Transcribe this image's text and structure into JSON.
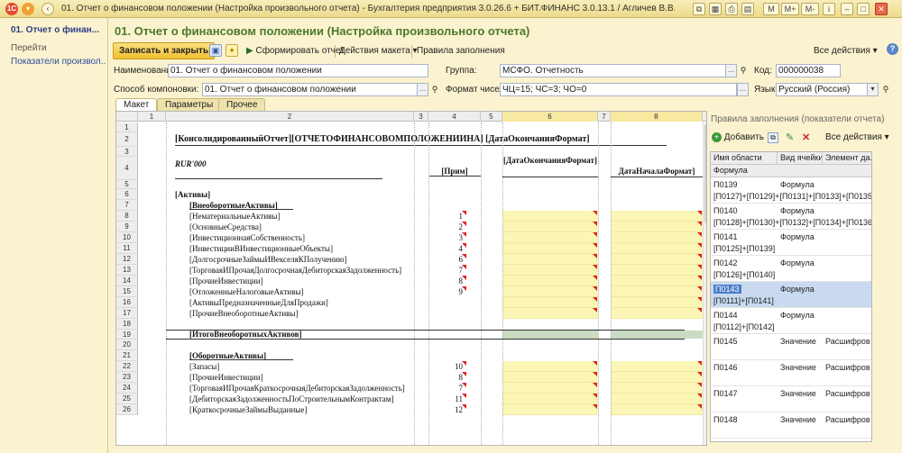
{
  "window": {
    "title": "01. Отчет о финансовом положении (Настройка произвольного отчета) - Бухгалтерия предприятия 3.0.26.6 + БИТ.ФИНАНС 3.0.13.1 / Агличев В.В. / Бу... (1С:Предприятие)",
    "buttons": [
      "M",
      "M+",
      "M-"
    ]
  },
  "left_panel": {
    "heading": "01. Отчет о финан...",
    "section": "Перейти",
    "link": "Показатели произвол..."
  },
  "page": {
    "title": "01. Отчет о финансовом положении (Настройка произвольного отчета)"
  },
  "toolbar": {
    "save_close": "Записать и закрыть",
    "generate": "Сформировать отчет",
    "layout_actions": "Действия макета",
    "fill_rules": "Правила заполнения",
    "all_actions": "Все действия"
  },
  "form": {
    "name_label": "Наименование:",
    "name_value": "01. Отчет о финансовом положении",
    "group_label": "Группа:",
    "group_value": "МСФО. Отчетность",
    "code_label": "Код:",
    "code_value": "000000038",
    "layout_label": "Способ компоновки:",
    "layout_value": "01. Отчет о финансовом положении",
    "numfmt_label": "Формат чисел:",
    "numfmt_value": "ЧЦ=15; ЧС=3; ЧО=0",
    "lang_label": "Язык:",
    "lang_value": "Русский (Россия)"
  },
  "tabs": [
    "Макет",
    "Параметры",
    "Прочее"
  ],
  "sheet": {
    "columns": [
      "1",
      "2",
      "3",
      "4",
      "5",
      "6",
      "7",
      "8"
    ],
    "rows": [
      {
        "n": "1",
        "c2": "",
        "c4": "",
        "tri": false,
        "y": false,
        "g": false
      },
      {
        "n": "2",
        "c2": "[КонсолидированныйОтчет][ОТЧЕТОФИНАНСОВОМПОЛОЖЕНИИНА] [ДатаОкончанияФормат]",
        "c4": "",
        "tri": false,
        "y": false,
        "g": false
      },
      {
        "n": "3",
        "c2": "",
        "c4": "",
        "tri": false,
        "y": false,
        "g": false
      },
      {
        "n": "4",
        "c2": "RUR'000",
        "c4": "[Прим]",
        "c6": "[ДатаОкончанияФормат]",
        "c8": "ДатаНачалаФормат]",
        "tri": false,
        "y": false,
        "g": false
      },
      {
        "n": "5",
        "c2": "",
        "c4": "",
        "tri": false,
        "y": false,
        "g": false
      },
      {
        "n": "6",
        "c2": "[Активы]",
        "c4": "",
        "tri": false,
        "y": false,
        "g": false
      },
      {
        "n": "7",
        "c2": "[ВнеоборотныеАктивы]",
        "c4": "",
        "tri": false,
        "y": false,
        "g": false
      },
      {
        "n": "8",
        "c2": "[НематериальныеАктивы]",
        "c4": "1",
        "tri": true,
        "y": true,
        "g": false
      },
      {
        "n": "9",
        "c2": "[ОсновныеСредства]",
        "c4": "2",
        "tri": true,
        "y": true,
        "g": false
      },
      {
        "n": "10",
        "c2": "[ИнвестиционнаяСобственность]",
        "c4": "3",
        "tri": true,
        "y": true,
        "g": false
      },
      {
        "n": "11",
        "c2": "[ИнвестицииВИнвестиционныеОбъекты]",
        "c4": "4",
        "tri": true,
        "y": true,
        "g": false
      },
      {
        "n": "12",
        "c2": "[ДолгосрочныеЗаймыИВекселяКПолучению]",
        "c4": "6",
        "tri": true,
        "y": true,
        "g": false
      },
      {
        "n": "13",
        "c2": "[ТорговаяИПрочаяДолгосрочнаяДебиторскаяЗадолженность]",
        "c4": "7",
        "tri": true,
        "y": true,
        "g": false
      },
      {
        "n": "14",
        "c2": "[ПрочиеИнвестиции]",
        "c4": "8",
        "tri": true,
        "y": true,
        "g": false
      },
      {
        "n": "15",
        "c2": "[ОтложенныеНалоговыеАктивы]",
        "c4": "9",
        "tri": true,
        "y": true,
        "g": false
      },
      {
        "n": "16",
        "c2": "[АктивыПредназначенныеДляПродажи]",
        "c4": "",
        "tri": false,
        "y": true,
        "g": false
      },
      {
        "n": "17",
        "c2": "[ПрочиеВнеоборотныеАктивы]",
        "c4": "",
        "tri": false,
        "y": true,
        "g": false
      },
      {
        "n": "18",
        "c2": "",
        "c4": "",
        "tri": false,
        "y": false,
        "g": false
      },
      {
        "n": "19",
        "c2": "[ИтогоВнеоборотныхАктивов]",
        "c4": "",
        "tri": false,
        "y": false,
        "g": true
      },
      {
        "n": "20",
        "c2": "",
        "c4": "",
        "tri": false,
        "y": false,
        "g": false
      },
      {
        "n": "21",
        "c2": "[ОборотныеАктивы]",
        "c4": "",
        "tri": false,
        "y": false,
        "g": false
      },
      {
        "n": "22",
        "c2": "[Запасы]",
        "c4": "10",
        "tri": true,
        "y": true,
        "g": false
      },
      {
        "n": "23",
        "c2": "[ПрочиеИнвестиции]",
        "c4": "8",
        "tri": true,
        "y": true,
        "g": false
      },
      {
        "n": "24",
        "c2": "[ТорговаяИПрочаяКраткосрочнаяДебиторскаяЗадолженность]",
        "c4": "7",
        "tri": true,
        "y": true,
        "g": false
      },
      {
        "n": "25",
        "c2": "[ДебиторскаяЗадолженностьПоСтроительнымКонтрактам]",
        "c4": "11",
        "tri": true,
        "y": true,
        "g": false
      },
      {
        "n": "26",
        "c2": "[КраткосрочныеЗаймыВыданные]",
        "c4": "12",
        "tri": true,
        "y": true,
        "g": false
      }
    ]
  },
  "rules_panel": {
    "title": "Правила заполнения (показатели отчета)",
    "add": "Добавить",
    "all_actions": "Все действия",
    "col_area": "Имя области",
    "col_type": "Вид ячейки",
    "col_elem": "Элемент да...",
    "col_formula": "Формула",
    "rows": [
      {
        "name": "П0139",
        "type": "Формула",
        "elem": "",
        "formula": "[П0127]+[П0129]+[П0131]+[П0133]+[П0135]+[П",
        "sel": false
      },
      {
        "name": "П0140",
        "type": "Формула",
        "elem": "",
        "formula": "[П0128]+[П0130]+[П0132]+[П0134]+[П0136]+[П",
        "sel": false
      },
      {
        "name": "П0141",
        "type": "Формула",
        "elem": "",
        "formula": "[П0125]+[П0139]",
        "sel": false
      },
      {
        "name": "П0142",
        "type": "Формула",
        "elem": "",
        "formula": "[П0126]+[П0140]",
        "sel": false
      },
      {
        "name": "П0143",
        "type": "Формула",
        "elem": "",
        "formula": "[П0111]+[П0141]",
        "sel": true
      },
      {
        "name": "П0144",
        "type": "Формула",
        "elem": "",
        "formula": "[П0112]+[П0142]",
        "sel": false
      },
      {
        "name": "П0145",
        "type": "Значение",
        "elem": "Расшифров",
        "formula": "",
        "sel": false
      },
      {
        "name": "П0146",
        "type": "Значение",
        "elem": "Расшифров",
        "formula": "",
        "sel": false
      },
      {
        "name": "П0147",
        "type": "Значение",
        "elem": "Расшифров",
        "formula": "",
        "sel": false
      },
      {
        "name": "П0148",
        "type": "Значение",
        "elem": "Расшифров",
        "formula": "",
        "sel": false
      }
    ]
  }
}
